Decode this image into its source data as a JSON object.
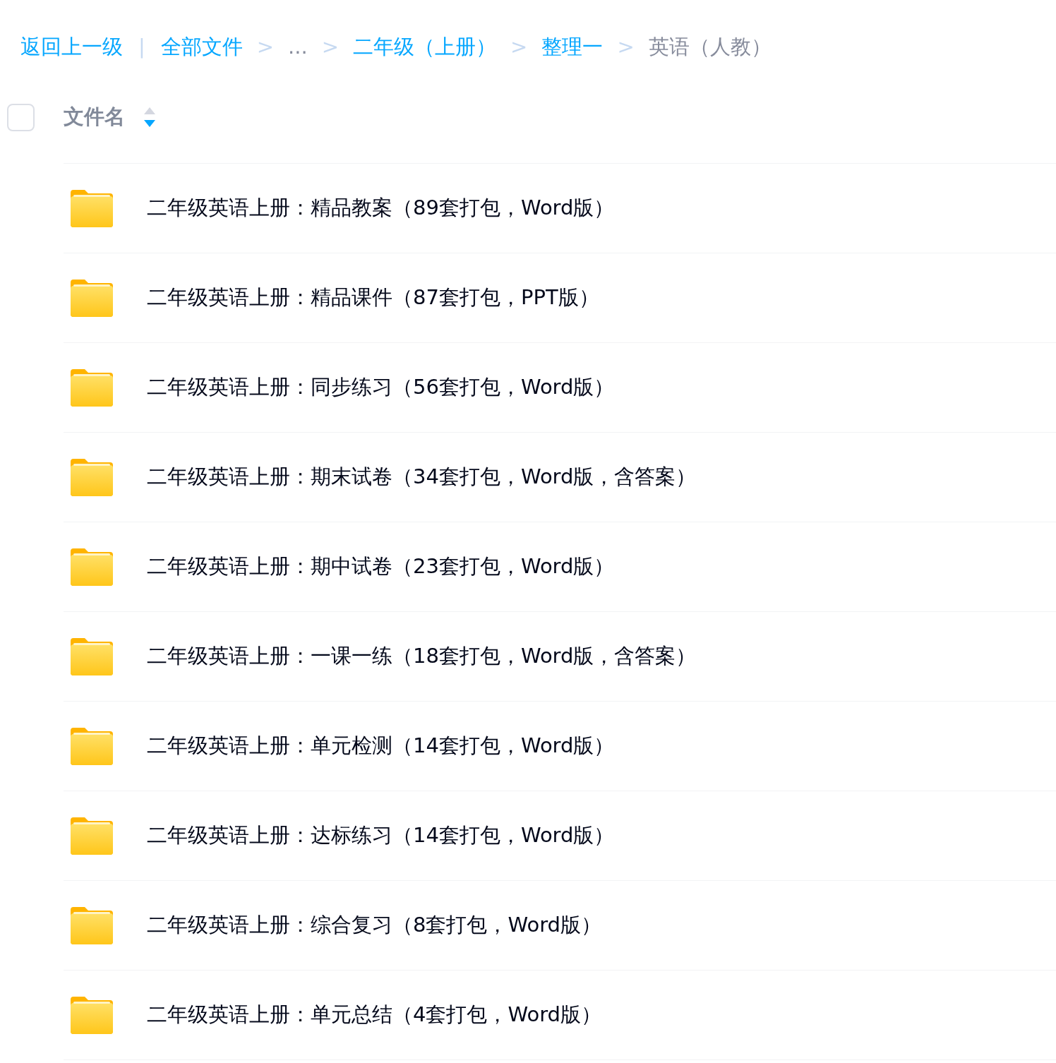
{
  "breadcrumb": {
    "back": "返回上一级",
    "divider": "|",
    "items": [
      {
        "label": "全部文件",
        "kind": "link"
      },
      {
        "separator": ">",
        "label": "...",
        "kind": "plain"
      },
      {
        "separator": ">",
        "label": "二年级（上册）",
        "kind": "link"
      },
      {
        "separator": ">",
        "label": "整理一",
        "kind": "link"
      },
      {
        "separator": ">",
        "label": "英语（人教）",
        "kind": "current"
      }
    ]
  },
  "header": {
    "checked": false,
    "column": "文件名",
    "sort_descending": true
  },
  "files": [
    {
      "name": "二年级英语上册：精品教案（89套打包，Word版）"
    },
    {
      "name": "二年级英语上册：精品课件（87套打包，PPT版）"
    },
    {
      "name": "二年级英语上册：同步练习（56套打包，Word版）"
    },
    {
      "name": "二年级英语上册：期末试卷（34套打包，Word版，含答案）"
    },
    {
      "name": "二年级英语上册：期中试卷（23套打包，Word版）"
    },
    {
      "name": "二年级英语上册：一课一练（18套打包，Word版，含答案）"
    },
    {
      "name": "二年级英语上册：单元检测（14套打包，Word版）"
    },
    {
      "name": "二年级英语上册：达标练习（14套打包，Word版）"
    },
    {
      "name": "二年级英语上册：综合复习（8套打包，Word版）"
    },
    {
      "name": "二年级英语上册：单元总结（4套打包，Word版）"
    }
  ]
}
